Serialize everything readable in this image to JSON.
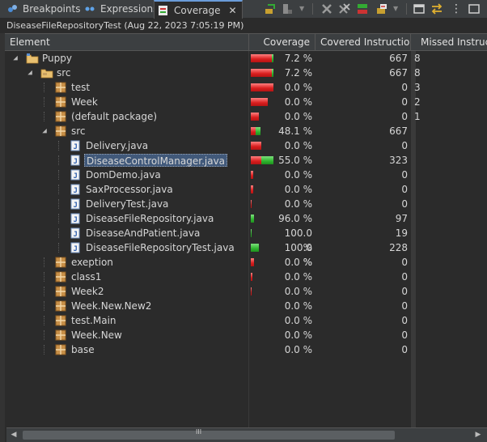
{
  "tabs": [
    {
      "label": "Breakpoints",
      "icon": "breakpoints-icon",
      "active": false
    },
    {
      "label": "Expressions",
      "icon": "expressions-icon",
      "active": false
    },
    {
      "label": "Coverage",
      "icon": "coverage-icon",
      "active": true
    }
  ],
  "toolbar": [
    "relaunch-icon",
    "merge-sessions-dropdown-icon",
    "remove-session-icon",
    "remove-all-sessions-icon",
    "collapse-all-icon",
    "link-with-selection-icon",
    "minimize-icon",
    "view-menu-icon"
  ],
  "session": {
    "title": "DiseaseFileRepositoryTest (Aug 22, 2023 7:05:19 PM)"
  },
  "columns": {
    "element": "Element",
    "coverage": "Coverage",
    "covered": "Covered Instructions",
    "missed": "Missed Instructions"
  },
  "colors": {
    "red": "#d81e1e",
    "green": "#2fb52f",
    "selection": "#41597a"
  },
  "rows": [
    {
      "label": "Puppy",
      "type": "project",
      "level": 0,
      "expander": "open",
      "coverage": "7.2 %",
      "cov": 0.072,
      "bar": 1.0,
      "covered": "667",
      "missed": "8"
    },
    {
      "label": "src",
      "type": "folder",
      "level": 1,
      "expander": "open",
      "coverage": "7.2 %",
      "cov": 0.072,
      "bar": 1.0,
      "covered": "667",
      "missed": "8"
    },
    {
      "label": "test",
      "type": "package",
      "level": 2,
      "expander": "none",
      "coverage": "0.0 %",
      "cov": 0.0,
      "bar": 1.0,
      "covered": "0",
      "missed": "3"
    },
    {
      "label": "Week",
      "type": "package",
      "level": 2,
      "expander": "none",
      "coverage": "0.0 %",
      "cov": 0.0,
      "bar": 0.75,
      "covered": "0",
      "missed": "2"
    },
    {
      "label": "(default package)",
      "type": "package",
      "level": 2,
      "expander": "none",
      "coverage": "0.0 %",
      "cov": 0.0,
      "bar": 0.35,
      "covered": "0",
      "missed": "1"
    },
    {
      "label": "src",
      "type": "package",
      "level": 2,
      "expander": "open",
      "coverage": "48.1 %",
      "cov": 0.481,
      "bar": 0.42,
      "covered": "667",
      "missed": ""
    },
    {
      "label": "Delivery.java",
      "type": "java",
      "level": 3,
      "expander": "none",
      "coverage": "0.0 %",
      "cov": 0.0,
      "bar": 0.48,
      "covered": "0",
      "missed": ""
    },
    {
      "label": "DiseaseControlManager.java",
      "type": "java",
      "level": 3,
      "expander": "none",
      "coverage": "55.0 %",
      "cov": 0.55,
      "bar": 1.0,
      "covered": "323",
      "missed": "",
      "selected": true
    },
    {
      "label": "DomDemo.java",
      "type": "java",
      "level": 3,
      "expander": "none",
      "coverage": "0.0 %",
      "cov": 0.0,
      "bar": 0.1,
      "covered": "0",
      "missed": ""
    },
    {
      "label": "SaxProcessor.java",
      "type": "java",
      "level": 3,
      "expander": "none",
      "coverage": "0.0 %",
      "cov": 0.0,
      "bar": 0.1,
      "covered": "0",
      "missed": ""
    },
    {
      "label": "DeliveryTest.java",
      "type": "java",
      "level": 3,
      "expander": "none",
      "coverage": "0.0 %",
      "cov": 0.0,
      "bar": 0.04,
      "covered": "0",
      "missed": ""
    },
    {
      "label": "DiseaseFileRepository.java",
      "type": "java",
      "level": 3,
      "expander": "none",
      "coverage": "96.0 %",
      "cov": 0.96,
      "bar": 0.13,
      "covered": "97",
      "missed": ""
    },
    {
      "label": "DiseaseAndPatient.java",
      "type": "java",
      "level": 3,
      "expander": "none",
      "coverage": "100.0 %",
      "cov": 1.0,
      "bar": 0.03,
      "covered": "19",
      "missed": ""
    },
    {
      "label": "DiseaseFileRepositoryTest.java",
      "type": "java",
      "level": 3,
      "expander": "none",
      "coverage": "100.0 %",
      "cov": 1.0,
      "bar": 0.34,
      "covered": "228",
      "missed": ""
    },
    {
      "label": "exeption",
      "type": "package",
      "level": 2,
      "expander": "none",
      "coverage": "0.0 %",
      "cov": 0.0,
      "bar": 0.15,
      "covered": "0",
      "missed": ""
    },
    {
      "label": "class1",
      "type": "package",
      "level": 2,
      "expander": "none",
      "coverage": "0.0 %",
      "cov": 0.0,
      "bar": 0.08,
      "covered": "0",
      "missed": ""
    },
    {
      "label": "Week2",
      "type": "package",
      "level": 2,
      "expander": "none",
      "coverage": "0.0 %",
      "cov": 0.0,
      "bar": 0.04,
      "covered": "0",
      "missed": ""
    },
    {
      "label": "Week.New.New2",
      "type": "package",
      "level": 2,
      "expander": "none",
      "coverage": "0.0 %",
      "cov": 0.0,
      "bar": 0.0,
      "covered": "0",
      "missed": ""
    },
    {
      "label": "test.Main",
      "type": "package",
      "level": 2,
      "expander": "none",
      "coverage": "0.0 %",
      "cov": 0.0,
      "bar": 0.0,
      "covered": "0",
      "missed": ""
    },
    {
      "label": "Week.New",
      "type": "package",
      "level": 2,
      "expander": "none",
      "coverage": "0.0 %",
      "cov": 0.0,
      "bar": 0.0,
      "covered": "0",
      "missed": ""
    },
    {
      "label": "base",
      "type": "package",
      "level": 2,
      "expander": "none",
      "coverage": "0.0 %",
      "cov": 0.0,
      "bar": 0.0,
      "covered": "0",
      "missed": ""
    }
  ],
  "scrollbar": {
    "thumb_grip": "III"
  }
}
